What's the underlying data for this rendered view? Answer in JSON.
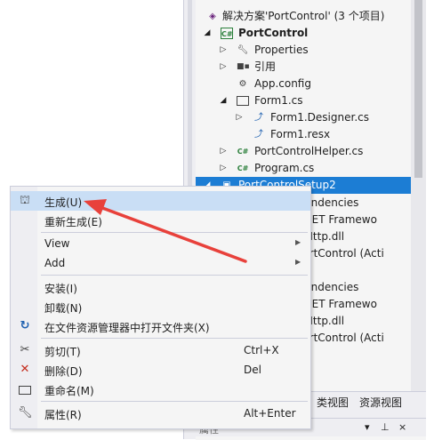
{
  "explorer": {
    "rows": [
      {
        "label": "解决方案'PortControl' (3 个项目)",
        "icon": "solution-icon",
        "expander": ""
      },
      {
        "label": "PortControl",
        "icon": "csharp-project-icon",
        "expander": "◢"
      },
      {
        "label": "Properties",
        "icon": "wrench-icon",
        "expander": "▷"
      },
      {
        "label": "引用",
        "icon": "references-icon",
        "expander": "▷"
      },
      {
        "label": "App.config",
        "icon": "config-file-icon",
        "expander": ""
      },
      {
        "label": "Form1.cs",
        "icon": "form-icon",
        "expander": "◢"
      },
      {
        "label": "Form1.Designer.cs",
        "icon": "designer-file-icon",
        "expander": "▷"
      },
      {
        "label": "Form1.resx",
        "icon": "resx-file-icon",
        "expander": ""
      },
      {
        "label": "PortControlHelper.cs",
        "icon": "csharp-file-icon",
        "expander": "▷"
      },
      {
        "label": "Program.cs",
        "icon": "csharp-file-icon",
        "expander": "▷"
      },
      {
        "label": "PortControlSetup2",
        "icon": "setup-project-icon",
        "expander": "◢"
      }
    ],
    "partial_rows": [
      "Dependencies",
      "oft .NET Framewo",
      "Net.Http.dll",
      "m PortControl (Acti",
      "Dependencies",
      "oft .NET Framewo",
      "Net.Http.dll",
      "m PortControl (Acti"
    ]
  },
  "tabs": {
    "class_view": "类视图",
    "resource_view": "资源视图"
  },
  "properties": {
    "title": "属性",
    "pin": "⊥",
    "close": "×",
    "dropdown": "▾"
  },
  "menu": {
    "items": [
      {
        "label": "生成(U)",
        "shortcut": "",
        "icon": "build-icon",
        "submenu": false
      },
      {
        "label": "重新生成(E)",
        "shortcut": "",
        "icon": "",
        "submenu": false
      },
      {
        "label": "View",
        "shortcut": "",
        "icon": "",
        "submenu": true
      },
      {
        "label": "Add",
        "shortcut": "",
        "icon": "",
        "submenu": true
      },
      {
        "label": "安装(I)",
        "shortcut": "",
        "icon": "",
        "submenu": false
      },
      {
        "label": "卸载(N)",
        "shortcut": "",
        "icon": "",
        "submenu": false
      },
      {
        "label": "在文件资源管理器中打开文件夹(X)",
        "shortcut": "",
        "icon": "open-folder-icon",
        "submenu": false
      },
      {
        "label": "剪切(T)",
        "shortcut": "Ctrl+X",
        "icon": "scissors-icon",
        "submenu": false
      },
      {
        "label": "删除(D)",
        "shortcut": "Del",
        "icon": "delete-icon",
        "submenu": false
      },
      {
        "label": "重命名(M)",
        "shortcut": "",
        "icon": "rename-icon",
        "submenu": false
      },
      {
        "label": "属性(R)",
        "shortcut": "Alt+Enter",
        "icon": "wrench-icon",
        "submenu": false
      }
    ]
  },
  "colors": {
    "selection": "#1c7dd4",
    "hover": "#c9def5",
    "annotation_arrow": "#e8413b"
  }
}
